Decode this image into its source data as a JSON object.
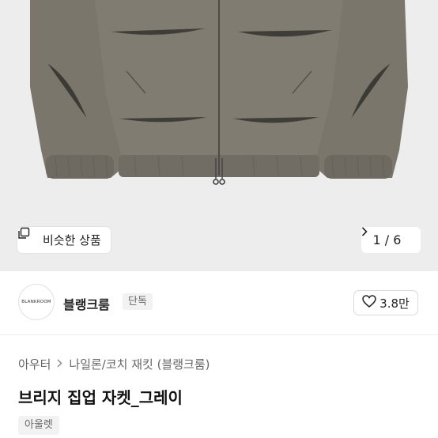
{
  "gallery": {
    "similar_label": "비슷한 상품",
    "pager_text": "1 / 6",
    "pager_next_icon": "chevron-right-icon",
    "similar_icon": "copy-icon"
  },
  "shop": {
    "logo_text": "BLANKROOM",
    "name": "블랭크룸",
    "badge": "단독",
    "rating": "3.8만",
    "rating_icon": "heart-icon"
  },
  "product": {
    "breadcrumb": [
      "아우터",
      "나일론/코치 재킷 (블랭크룸)"
    ],
    "breadcrumb_sep_icon": "chevron-right-icon",
    "title": "브리지 집업 자켓_그레이",
    "tag": "아울렛"
  },
  "colors": {
    "background": "#ededed",
    "jacket": "#7b776d",
    "text": "#222222"
  }
}
